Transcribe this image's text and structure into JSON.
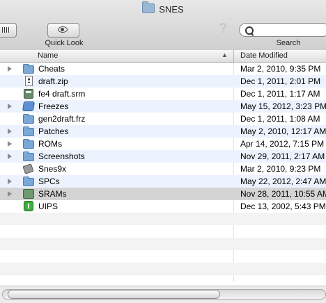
{
  "window": {
    "title": "SNES"
  },
  "toolbar": {
    "quick_look_label": "Quick Look",
    "search_label": "Search"
  },
  "columns": {
    "name": "Name",
    "date_modified": "Date Modified"
  },
  "files": [
    {
      "name": "Cheats",
      "date": "Mar 2, 2010, 9:35 PM",
      "icon": "folder-icon",
      "expandable": true
    },
    {
      "name": "draft.zip",
      "date": "Dec 1, 2011, 2:01 PM",
      "icon": "zip-document-icon",
      "expandable": false
    },
    {
      "name": "fe4 draft.srm",
      "date": "Dec 1, 2011, 1:17 AM",
      "icon": "srm-file-icon",
      "expandable": false
    },
    {
      "name": "Freezes",
      "date": "May 15, 2012, 3:23 PM",
      "icon": "freezes-folder-icon",
      "expandable": true
    },
    {
      "name": "gen2draft.frz",
      "date": "Dec 1, 2011, 1:08 AM",
      "icon": "frz-file-icon",
      "expandable": false
    },
    {
      "name": "Patches",
      "date": "May 2, 2010, 12:17 AM",
      "icon": "folder-icon",
      "expandable": true
    },
    {
      "name": "ROMs",
      "date": "Apr 14, 2012, 7:15 PM",
      "icon": "folder-icon",
      "expandable": true
    },
    {
      "name": "Screenshots",
      "date": "Nov 29, 2011, 2:17 AM",
      "icon": "folder-icon",
      "expandable": true
    },
    {
      "name": "Snes9x",
      "date": "Mar 2, 2010, 9:23 PM",
      "icon": "app-icon",
      "expandable": false
    },
    {
      "name": "SPCs",
      "date": "May 22, 2012, 2:47 AM",
      "icon": "folder-icon",
      "expandable": true
    },
    {
      "name": "SRAMs",
      "date": "Nov 28, 2011, 10:55 AM",
      "icon": "srams-folder-icon",
      "expandable": true,
      "selected": true
    },
    {
      "name": "UIPS",
      "date": "Dec 13, 2002, 5:43 PM",
      "icon": "uips-app-icon",
      "expandable": false
    }
  ]
}
